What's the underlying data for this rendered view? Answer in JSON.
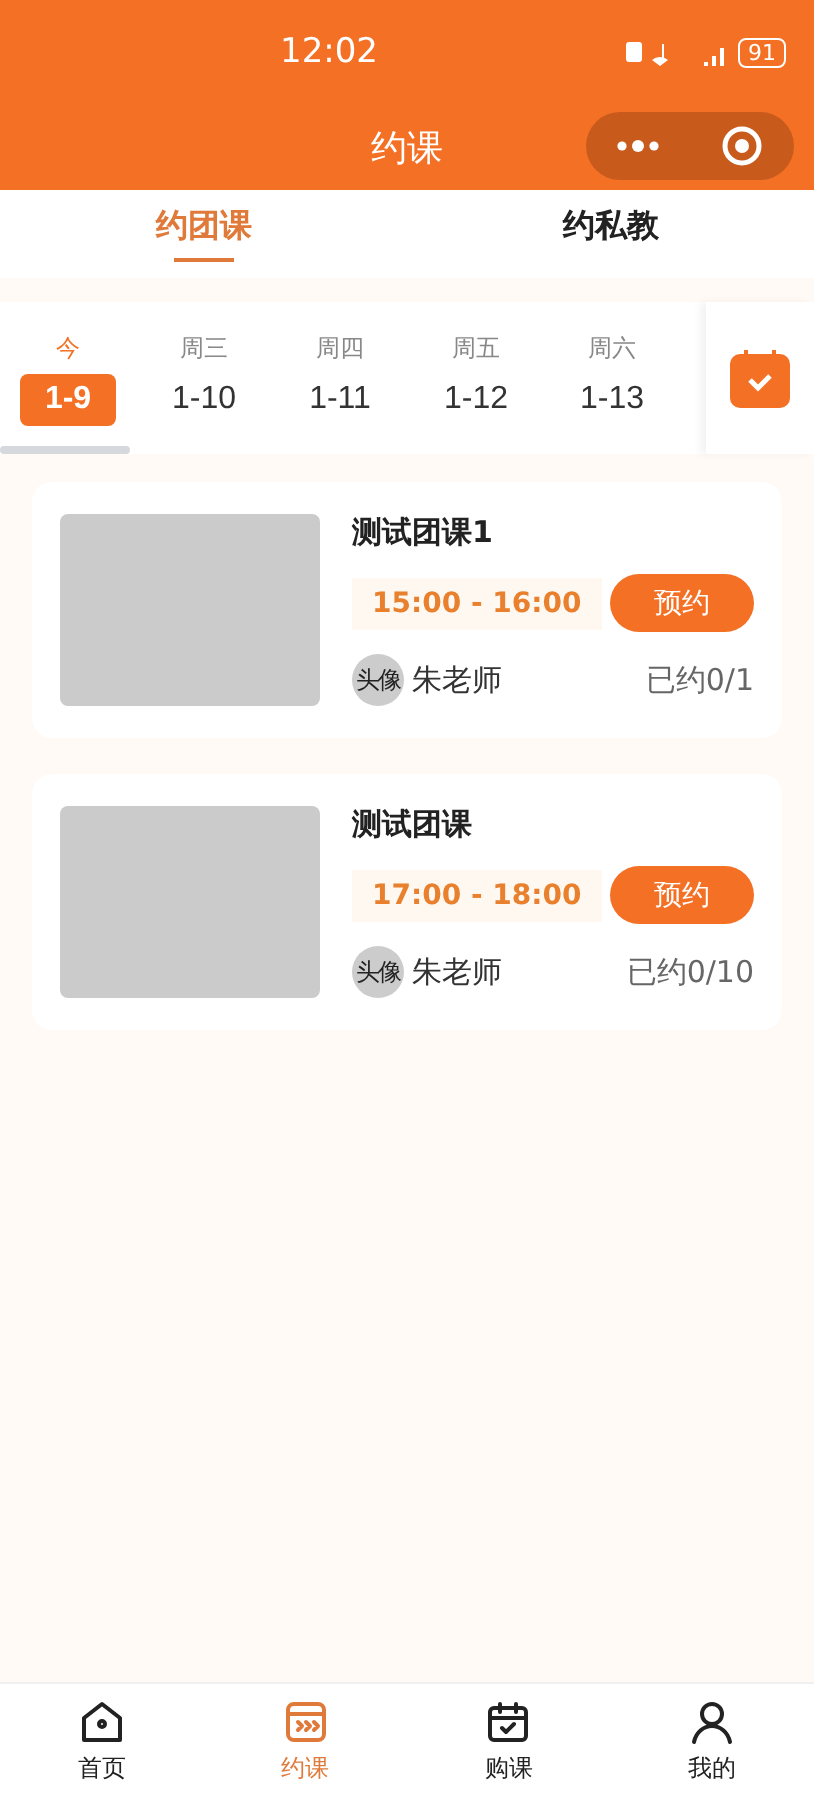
{
  "status_bar": {
    "time": "12:02",
    "battery": "91"
  },
  "header": {
    "title": "约课"
  },
  "tabs": [
    {
      "label": "约团课",
      "selected": true
    },
    {
      "label": "约私教",
      "selected": false
    }
  ],
  "dates": [
    {
      "weekday": "今",
      "date": "1-9",
      "selected": true
    },
    {
      "weekday": "周三",
      "date": "1-10",
      "selected": false
    },
    {
      "weekday": "周四",
      "date": "1-11",
      "selected": false
    },
    {
      "weekday": "周五",
      "date": "1-12",
      "selected": false
    },
    {
      "weekday": "周六",
      "date": "1-13",
      "selected": false
    }
  ],
  "classes": [
    {
      "name": "测试团课1",
      "time": "15:00 - 16:00",
      "button": "预约",
      "avatar": "头像",
      "teacher": "朱老师",
      "booked": "已约0/1"
    },
    {
      "name": "测试团课",
      "time": "17:00 - 18:00",
      "button": "预约",
      "avatar": "头像",
      "teacher": "朱老师",
      "booked": "已约0/10"
    }
  ],
  "bottom_nav": [
    {
      "label": "首页",
      "kind": "home",
      "selected": false
    },
    {
      "label": "约课",
      "kind": "book",
      "selected": true
    },
    {
      "label": "购课",
      "kind": "calendar",
      "selected": false
    },
    {
      "label": "我的",
      "kind": "user",
      "selected": false
    }
  ]
}
